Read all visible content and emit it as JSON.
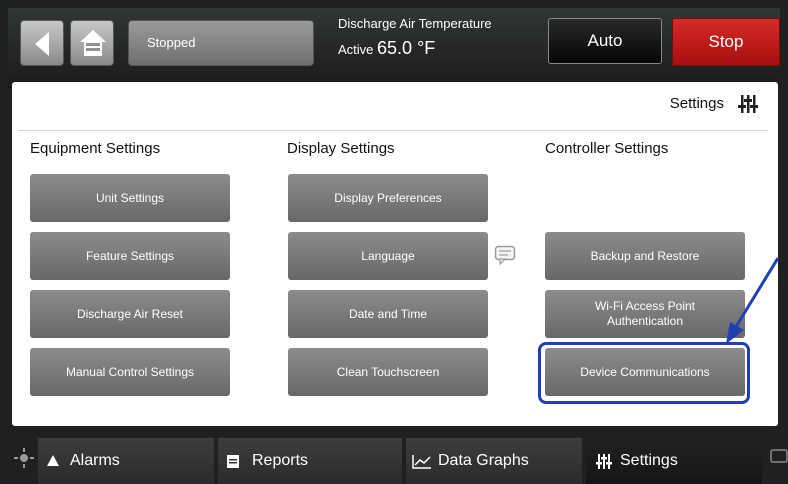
{
  "topbar": {
    "back_icon": "arrow-left-icon",
    "home_icon": "home-icon",
    "status": "Stopped",
    "dat_label": "Discharge Air Temperature",
    "dat_active": "Active",
    "dat_value": "65.0 °F",
    "auto_label": "Auto",
    "stop_label": "Stop"
  },
  "page": {
    "title": "Settings",
    "title_icon": "sliders-icon"
  },
  "columns": {
    "equipment": {
      "title": "Equipment Settings",
      "buttons": [
        "Unit Settings",
        "Feature Settings",
        "Discharge Air Reset",
        "Manual Control Settings"
      ]
    },
    "display": {
      "title": "Display Settings",
      "buttons": [
        "Display Preferences",
        "Language",
        "Date and Time",
        "Clean Touchscreen"
      ]
    },
    "controller": {
      "title": "Controller Settings",
      "buttons": [
        "Backup and Restore",
        "Wi-Fi Access Point Authentication",
        "Device Communications"
      ]
    }
  },
  "tabs": [
    {
      "label": "Alarms",
      "icon": "bell-icon"
    },
    {
      "label": "Reports",
      "icon": "document-icon"
    },
    {
      "label": "Data Graphs",
      "icon": "line-chart-icon"
    },
    {
      "label": "Settings",
      "icon": "sliders-icon"
    }
  ],
  "colors": {
    "stop": "#c41b1b",
    "button_gray": "#7a7a7a",
    "highlight": "#1f3fb3"
  }
}
